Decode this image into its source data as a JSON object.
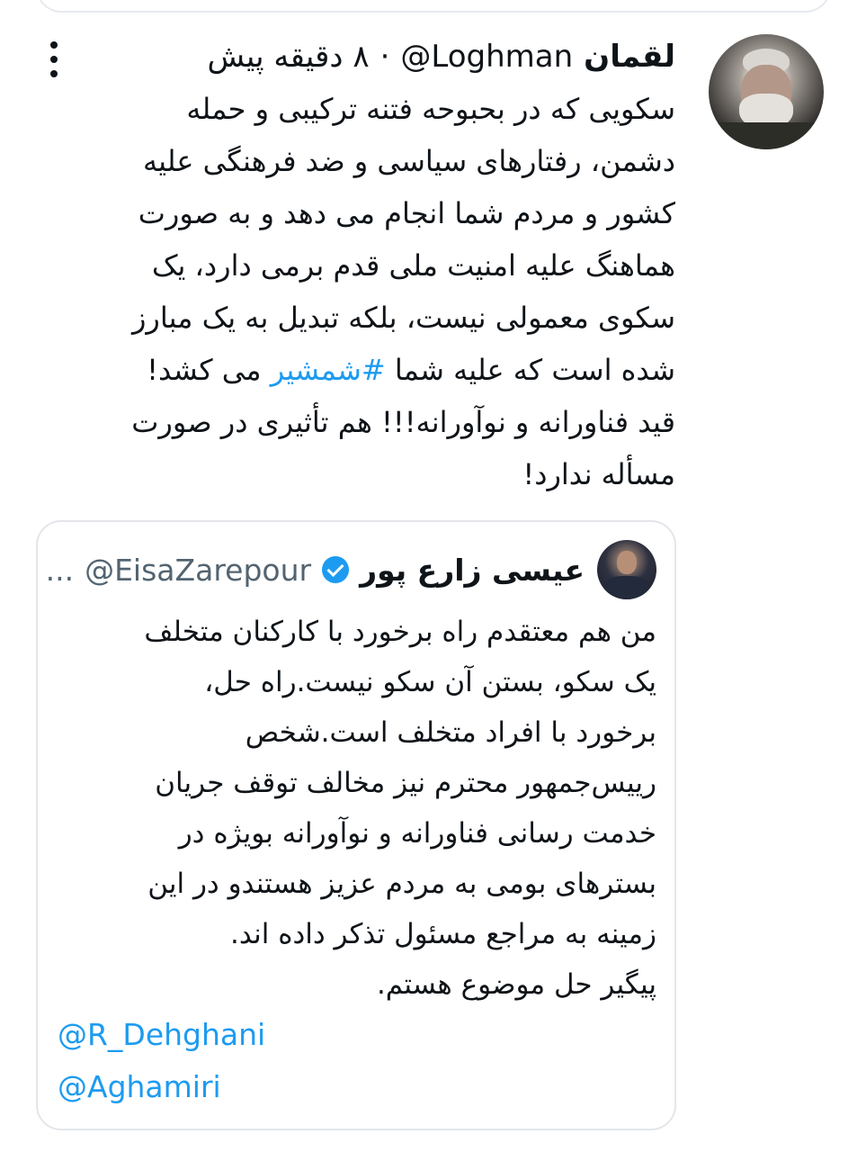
{
  "tweet": {
    "display_name": "لقمان",
    "handle": "@Loghman",
    "separator": "·",
    "time": "۸ دقیقه پیش",
    "body_lines": [
      "سکویی که در بحبوحه فتنه ترکیبی و حمله",
      "دشمن،  رفتارهای سیاسی و ضد فرهنگی علیه",
      "کشور و مردم شما انجام می دهد و به صورت",
      "هماهنگ علیه امنیت ملی قدم برمی دارد، یک",
      "سکوی معمولی نیست، بلکه تبدیل به یک مبارز"
    ],
    "line6_before": "شده است که علیه شما ",
    "hashtag": "#شمشیر",
    "line6_after": " می کشد!",
    "body_lines_end": [
      " قید فناورانه و نوآورانه!!! هم تأثیری در صورت",
      "مسأله ندارد!"
    ]
  },
  "quote": {
    "display_name": "عیسی زارع پور",
    "handle": "@EisaZarepour",
    "ellipsis": "...",
    "body_lines": [
      "من هم معتقدم راه برخورد با کارکنان متخلف",
      "یک سکو، بستن آن سکو نیست.راه حل،",
      "برخورد با افراد متخلف است.شخص",
      "رییس‌جمهور محترم نیز مخالف توقف جریان",
      "خدمت رسانی فناورانه و نوآورانه بویژه در",
      "بسترهای بومی به مردم عزیز هستندو در این",
      "زمینه به مراجع مسئول تذکر داده اند.",
      "پیگیر حل موضوع هستم."
    ],
    "mentions": [
      "@R_Dehghani",
      "@Aghamiri"
    ]
  }
}
